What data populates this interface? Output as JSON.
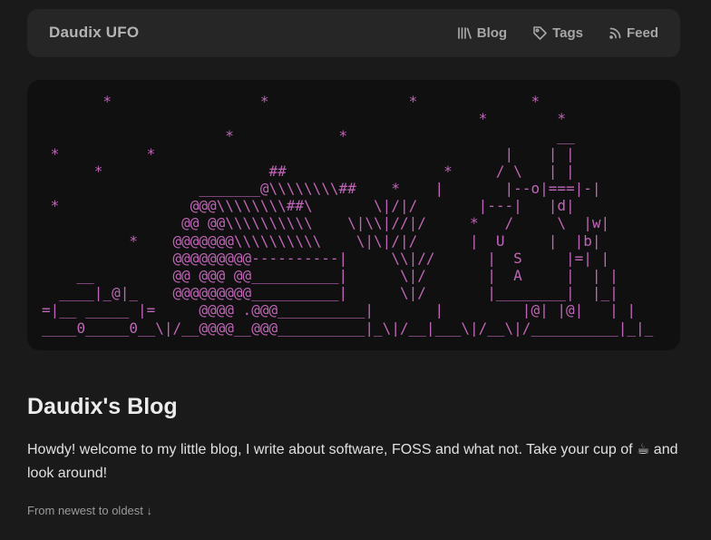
{
  "nav": {
    "brand": "Daudix UFO",
    "links": [
      {
        "label": "Blog",
        "icon": "books-icon"
      },
      {
        "label": "Tags",
        "icon": "tag-icon"
      },
      {
        "label": "Feed",
        "icon": "rss-icon"
      }
    ]
  },
  "banner": {
    "ascii": "       *                 *                *             *\n                                                  *        *\n                     *            *                        __\n *          *                                        |    | |\n      *                   ##                  *     / \\   | |\n                  _______@\\\\\\\\\\\\\\\\##    *    |       |--o|===|-|\n *               @@@\\\\\\\\\\\\\\\\##\\       \\|/|/       |---|   |d|\n                @@ @@\\\\\\\\\\\\\\\\\\\\    \\|\\\\|//|/     *   /     \\  |w|\n          *    @@@@@@@\\\\\\\\\\\\\\\\\\\\    \\|\\|/|/      |  U     |  |b|\n               @@@@@@@@@----------|     \\\\|//      |  S     |=| |\n    __         @@ @@@ @@__________|      \\|/       |  A     |  | |\n  ____|_@|_    @@@@@@@@@__________|      \\|/       |________|  |_|\n=|__ _____ |=     @@@@ .@@@__________|       |         |@| |@|   | |\n____0_____0__\\|/__@@@@__@@@__________|_\\|/__|___\\|/__\\|/__________|_|_"
  },
  "main": {
    "title": "Daudix's Blog",
    "intro": "Howdy! welcome to my little blog, I write about software, FOSS and what not. Take your cup of ☕ and look around!",
    "sort_label": "From newest to oldest ↓"
  }
}
